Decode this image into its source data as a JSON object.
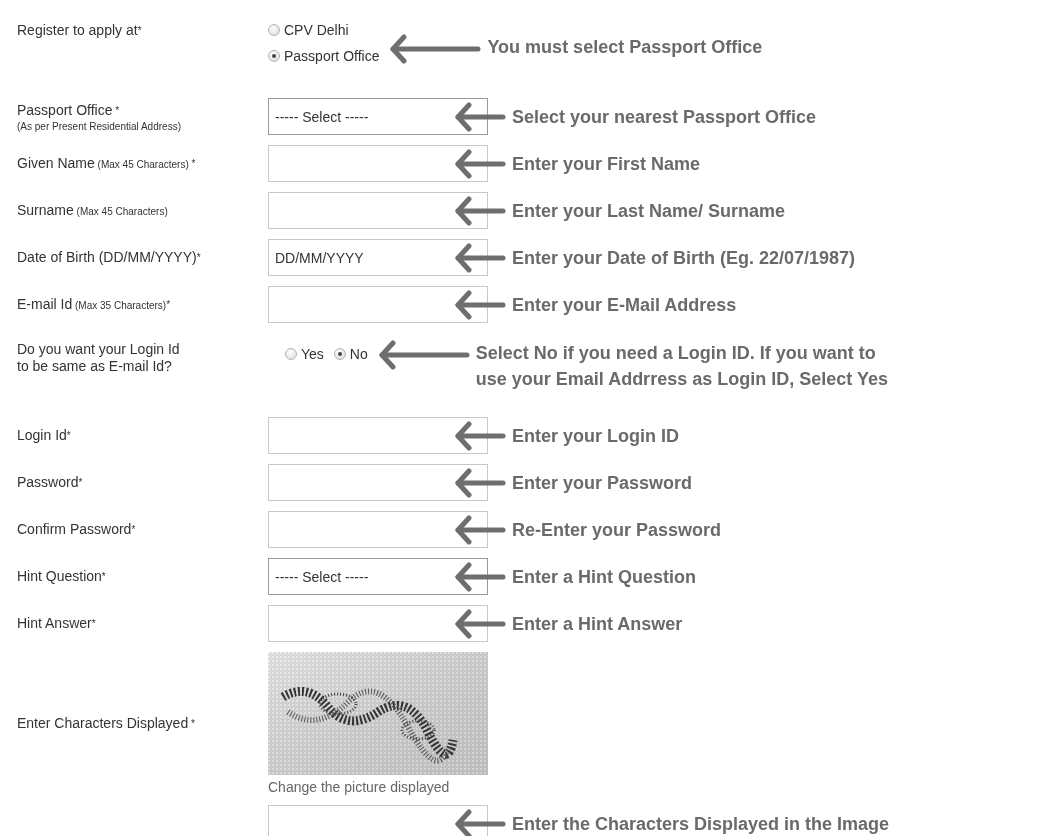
{
  "form": {
    "rows": [
      {
        "kind": "radio_stack",
        "label": "Register to apply at",
        "mark": "*",
        "options": [
          {
            "label": "CPV Delhi",
            "selected": false
          },
          {
            "label": "Passport Office",
            "selected": true
          }
        ],
        "annotation": "You must select Passport Office"
      },
      {
        "kind": "select",
        "label": "Passport Office",
        "mark": " *",
        "subnote": "(As per Present Residential Address)",
        "value": "----- Select -----",
        "annotation": "Select your nearest Passport Office"
      },
      {
        "kind": "text",
        "label": "Given Name",
        "note": "(Max 45 Characters)",
        "mark": " *",
        "annotation": "Enter your First Name"
      },
      {
        "kind": "text",
        "label": "Surname",
        "note": "(Max 45 Characters)",
        "annotation": "Enter your Last Name/ Surname"
      },
      {
        "kind": "text",
        "label": "Date of Birth (DD/MM/YYYY)",
        "mark": "*",
        "value": "DD/MM/YYYY",
        "annotation": "Enter your Date of Birth (Eg. 22/07/1987)"
      },
      {
        "kind": "text",
        "label": "E-mail Id",
        "note": "(Max 35 Characters)",
        "mark": "*",
        "annotation": "Enter your E-Mail Address"
      },
      {
        "kind": "radio_inline",
        "label": "Do you want your Login Id\n to be same as E-mail Id?",
        "options": [
          {
            "label": "Yes",
            "selected": false
          },
          {
            "label": "No",
            "selected": true
          }
        ],
        "annotation": "Select No if you need a Login ID. If you want to\nuse your Email Addrress as Login ID, Select Yes"
      },
      {
        "kind": "text",
        "label": "Login Id",
        "mark": "*",
        "annotation": "Enter your Login ID"
      },
      {
        "kind": "text",
        "label": "Password",
        "mark": "*",
        "annotation": "Enter your Password"
      },
      {
        "kind": "text",
        "label": "Confirm Password",
        "mark": "*",
        "annotation": "Re-Enter your Password"
      },
      {
        "kind": "select",
        "label": "Hint Question",
        "mark": "*",
        "value": "----- Select -----",
        "annotation": "Enter a Hint Question"
      },
      {
        "kind": "text",
        "label": "Hint Answer",
        "mark": "*",
        "annotation": "Enter a Hint Answer"
      },
      {
        "kind": "captcha",
        "label": "Enter Characters Displayed",
        "mark": " *",
        "link": "Change the picture displayed"
      },
      {
        "kind": "text",
        "annotation": "Enter the Characters Displayed in the Image"
      }
    ]
  }
}
